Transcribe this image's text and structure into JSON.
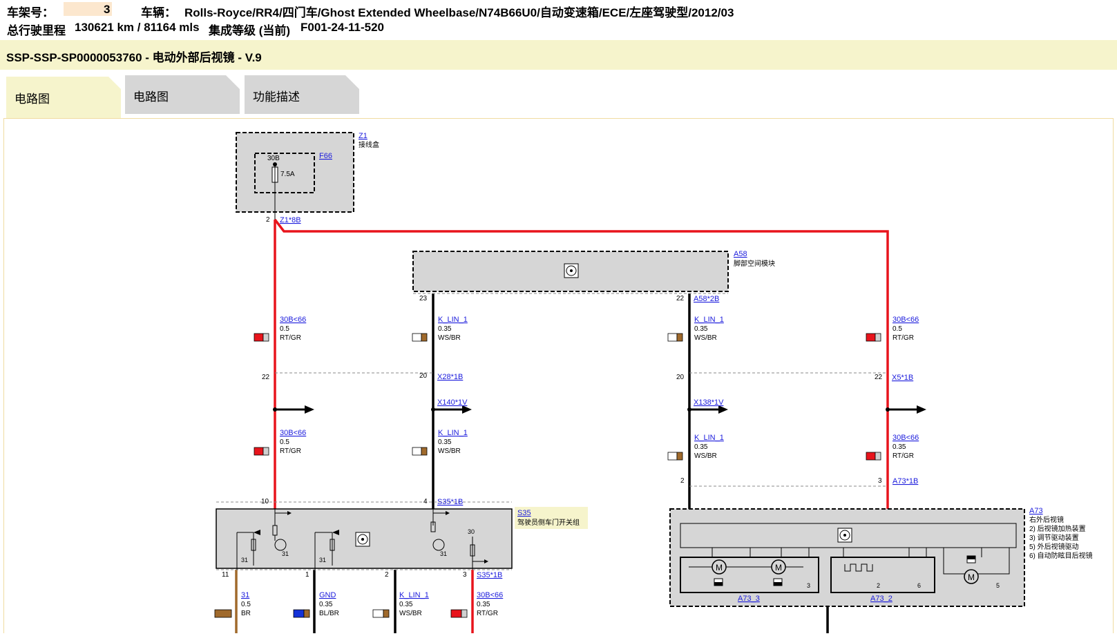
{
  "header": {
    "vin_label": "车架号：",
    "vin_value": "3",
    "vehicle_label": "车辆：",
    "vehicle_value": "Rolls-Royce/RR4/四门车/Ghost Extended Wheelbase/N74B66U0/自动变速箱/ECE/左座驾驶型/2012/03",
    "mileage_label": "总行驶里程",
    "mileage_value": "130621 km / 81164 mls",
    "integration_label": "集成等级 (当前)",
    "integration_value": "F001-24-11-520"
  },
  "title": "SSP-SSP-SP0000053760 - 电动外部后视镜 - V.9",
  "tabs": [
    {
      "label": "电路图",
      "active": true
    },
    {
      "label": "电路图",
      "active": false
    },
    {
      "label": "功能描述",
      "active": false
    }
  ],
  "colors": {
    "power_wire": "#e8141c",
    "signal_wire": "#000000",
    "ground_wire": "#a06a2c",
    "box_fill": "#d6d6d6",
    "link": "#1a1adc"
  },
  "diagram": {
    "z1": {
      "id": "Z1",
      "desc": "接线盒",
      "fuse_id": "F66",
      "fuse_terminal": "30B",
      "fuse_rating": "7.5A",
      "pin": "2",
      "connector": "Z1*8B"
    },
    "a58": {
      "id": "A58",
      "desc": "脚部空间模块",
      "connector": "A58*2B",
      "pin_left": "23",
      "pin_right": "22",
      "icon": "control-module-icon"
    },
    "s35": {
      "id": "S35",
      "desc": "驾驶员侧车门开关组",
      "top_connector": "S35*1B",
      "bottom_connector": "S35*1B",
      "top_pins": [
        "10",
        "4"
      ],
      "bottom_pins": [
        "11",
        "1",
        "2",
        "3"
      ],
      "ground_labels": [
        "31",
        "31",
        "31",
        "31"
      ],
      "terminal_30": "30"
    },
    "a73": {
      "id": "A73",
      "desc_lines": [
        "右外后视镜",
        "2)  后视镜加热装置",
        "3)  调节驱动装置",
        "5)  外后视镜驱动",
        "6)  自动防眩目后视镜"
      ],
      "connector": "A73*1B",
      "sub_left": "A73_3",
      "sub_right": "A73_2",
      "sub_pins": [
        "3",
        "2",
        "6",
        "5"
      ],
      "pin_left": "2",
      "pin_right": "3"
    },
    "connectors": {
      "x28": "X28*1B",
      "x5": "X5*1B",
      "x140": "X140*1V",
      "x138": "X138*1V",
      "x28_pins": [
        "22",
        "20"
      ],
      "x5_pins": [
        "20",
        "22"
      ]
    },
    "wires": {
      "w_30b_1": {
        "name": "30B<66",
        "size": "0.5",
        "color": "RT/GR"
      },
      "w_klin_1": {
        "name": "K_LIN_1",
        "size": "0.35",
        "color": "WS/BR"
      },
      "w_klin_2": {
        "name": "K_LIN_1",
        "size": "0.35",
        "color": "WS/BR"
      },
      "w_30b_2": {
        "name": "30B<66",
        "size": "0.5",
        "color": "RT/GR"
      },
      "w_30b_3": {
        "name": "30B<66",
        "size": "0.5",
        "color": "RT/GR"
      },
      "w_klin_3": {
        "name": "K_LIN_1",
        "size": "0.35",
        "color": "WS/BR"
      },
      "w_klin_4": {
        "name": "K_LIN_1",
        "size": "0.35",
        "color": "WS/BR"
      },
      "w_30b_4": {
        "name": "30B<66",
        "size": "0.35",
        "color": "RT/GR"
      },
      "w_31": {
        "name": "31",
        "size": "0.5",
        "color": "BR"
      },
      "w_gnd": {
        "name": "GND",
        "size": "0.35",
        "color": "BL/BR"
      },
      "w_klin_5": {
        "name": "K_LIN_1",
        "size": "0.35",
        "color": "WS/BR"
      },
      "w_30b_5": {
        "name": "30B<66",
        "size": "0.35",
        "color": "RT/GR"
      }
    }
  }
}
